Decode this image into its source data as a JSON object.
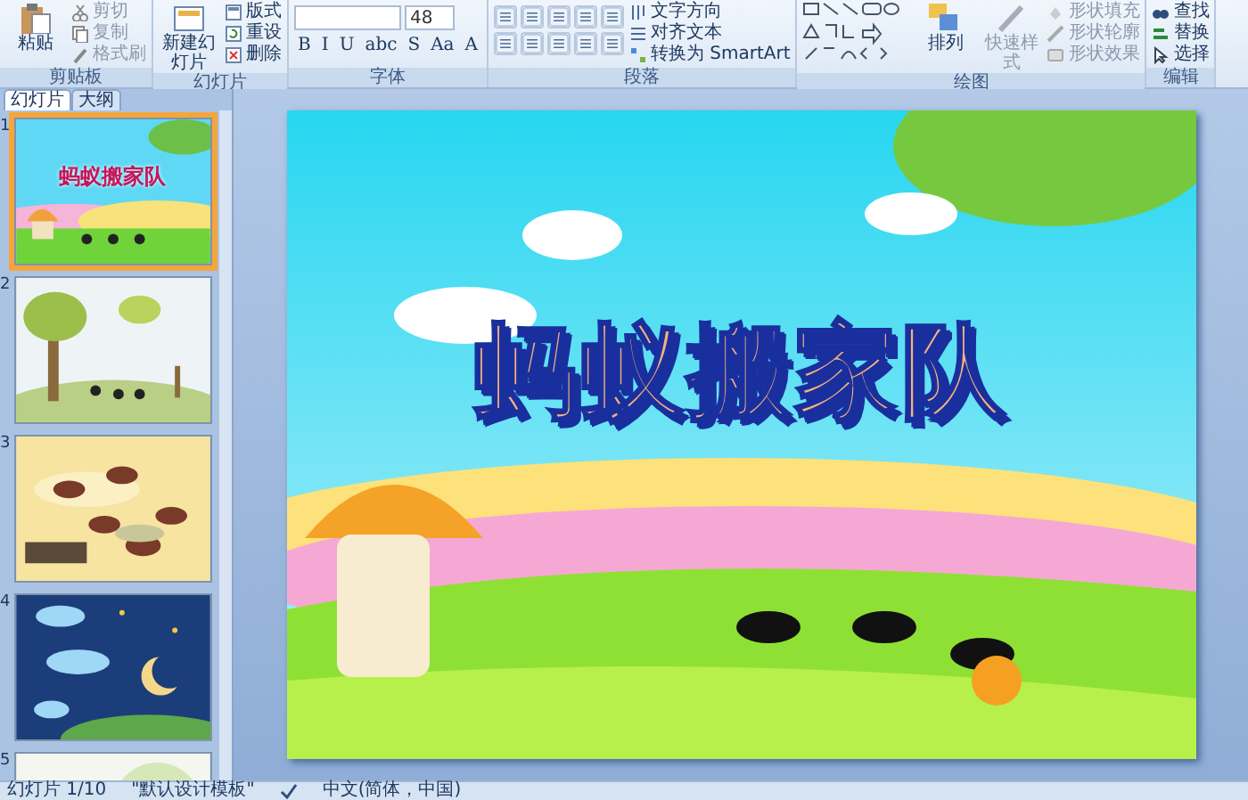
{
  "ribbon": {
    "groups": [
      {
        "label": "剪贴板",
        "items": [
          {
            "kind": "large",
            "label": "粘贴",
            "disabled": false
          },
          {
            "kind": "small",
            "label": "剪切",
            "disabled": true
          },
          {
            "kind": "small",
            "label": "复制",
            "disabled": true
          },
          {
            "kind": "small",
            "label": "格式刷",
            "disabled": true
          }
        ]
      },
      {
        "label": "幻灯片",
        "items": [
          {
            "kind": "large",
            "label": "新建幻灯片",
            "disabled": false
          },
          {
            "kind": "small",
            "label": "版式",
            "disabled": false
          },
          {
            "kind": "small",
            "label": "重设",
            "disabled": false
          },
          {
            "kind": "small",
            "label": "删除",
            "disabled": false
          }
        ]
      },
      {
        "label": "字体",
        "items": [
          {
            "kind": "font",
            "size": "48",
            "buttons": [
              "B",
              "I",
              "U",
              "abc",
              "S",
              "Aa",
              "A"
            ]
          }
        ]
      },
      {
        "label": "段落",
        "items": [
          {
            "kind": "para"
          },
          {
            "kind": "small",
            "label": "文字方向",
            "disabled": false
          },
          {
            "kind": "small",
            "label": "对齐文本",
            "disabled": false
          },
          {
            "kind": "small",
            "label": "转换为 SmartArt",
            "disabled": false
          }
        ]
      },
      {
        "label": "绘图",
        "items": [
          {
            "kind": "shapes"
          },
          {
            "kind": "large",
            "label": "排列",
            "disabled": false
          },
          {
            "kind": "large",
            "label": "快速样式",
            "disabled": true
          },
          {
            "kind": "small",
            "label": "形状填充",
            "disabled": true
          },
          {
            "kind": "small",
            "label": "形状轮廓",
            "disabled": true
          },
          {
            "kind": "small",
            "label": "形状效果",
            "disabled": true
          }
        ]
      },
      {
        "label": "编辑",
        "items": [
          {
            "kind": "small",
            "label": "查找",
            "disabled": false
          },
          {
            "kind": "small",
            "label": "替换",
            "disabled": false
          },
          {
            "kind": "small",
            "label": "选择",
            "disabled": false
          }
        ]
      }
    ]
  },
  "panel": {
    "tabs": [
      {
        "label": "幻灯片",
        "selected": true
      },
      {
        "label": "大纲",
        "selected": false
      }
    ],
    "slides": [
      {
        "number": "1",
        "selected": true,
        "title": "蚂蚁搬家队"
      },
      {
        "number": "2",
        "selected": false
      },
      {
        "number": "3",
        "selected": false
      },
      {
        "number": "4",
        "selected": false
      },
      {
        "number": "5",
        "selected": false
      }
    ]
  },
  "slide": {
    "title": "蚂蚁搬家队"
  },
  "status_bar": {
    "slide": "幻灯片 1/10",
    "theme": "\"默认设计模板\"",
    "language": "中文(简体，中国)"
  }
}
